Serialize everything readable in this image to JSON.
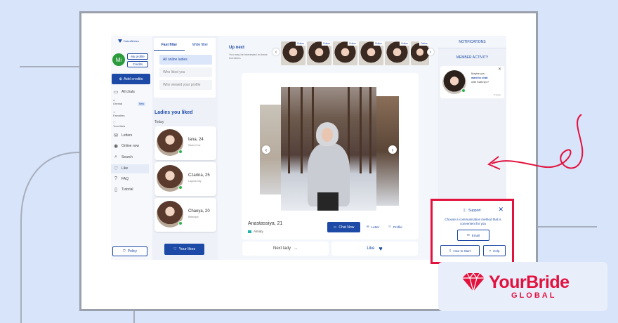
{
  "sidebar": {
    "logo": "DatesBrides",
    "avatar_initials": "Mi",
    "my_profile": "My profile",
    "credits": "Credits",
    "add_credits": "Add credits",
    "items": [
      {
        "label": "All chats"
      },
      {
        "label": "Unread",
        "badge": "New"
      },
      {
        "label": "Favorites"
      },
      {
        "label": "Your likes"
      },
      {
        "label": "Letters"
      },
      {
        "label": "Online now"
      },
      {
        "label": "Search"
      },
      {
        "label": "Like"
      },
      {
        "label": "FAQ"
      },
      {
        "label": "Tutorial"
      }
    ],
    "policy": "Policy"
  },
  "filters": {
    "tabs": [
      "Fast filter",
      "Wide filter"
    ],
    "options": [
      "All online ladies",
      "Who liked you",
      "Who viewed your profile"
    ],
    "liked_title": "Ladies you liked",
    "today": "Today",
    "cards": [
      {
        "name": "Iana, 24",
        "location": "Santa Cruz"
      },
      {
        "name": "Czarina, 25",
        "location": "Laguna City"
      },
      {
        "name": "Chaeya, 20",
        "location": "Batangas"
      }
    ],
    "your_likes": "Your likes"
  },
  "up_next": {
    "title": "Up next",
    "subtitle": "You may be interested in these members",
    "thumb_tag": "Online"
  },
  "profile": {
    "name": "Anastassiya, 21",
    "location": "Almaty",
    "chat_now": "Chat Now",
    "letter": "Letter",
    "profile": "Profile",
    "next_lady": "Next lady",
    "like": "Like"
  },
  "right": {
    "notifications": "NOTIFICATIONS",
    "member_activity": "MEMBER ACTIVITY",
    "activity_text_1": "Maybe you",
    "activity_text_2": "want to chat",
    "activity_text_3": "with Kathrlyn?",
    "activity_time": "Tt:Egpm"
  },
  "support": {
    "title": "Support",
    "description": "Choose a communication method that is convenient for you",
    "email": "Email",
    "how_to_start": "How to Start",
    "help": "Help"
  },
  "brand": {
    "name": "YourBride",
    "sub": "GLOBAL",
    "color": "#e2123f"
  },
  "colors": {
    "accent": "#1d4aa6",
    "online": "#28b44a",
    "highlight": "#e2123f"
  }
}
